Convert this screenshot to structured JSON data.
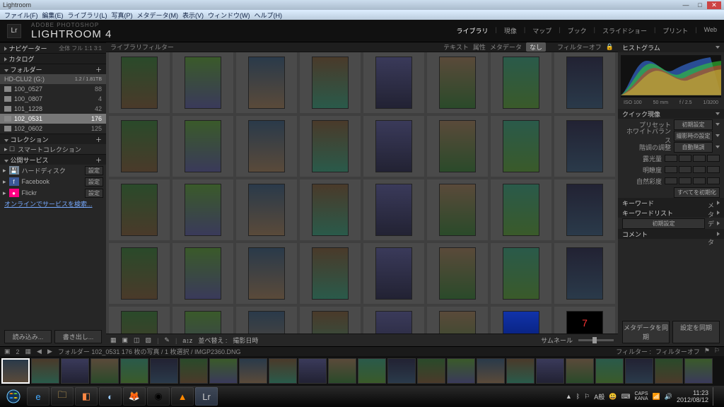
{
  "titlebar": {
    "title": "Lightroom"
  },
  "menubar": [
    "ファイル(F)",
    "編集(E)",
    "ライブラリ(L)",
    "写真(P)",
    "メタデータ(M)",
    "表示(V)",
    "ウィンドウ(W)",
    "ヘルプ(H)"
  ],
  "idplate": {
    "brand": "ADOBE PHOTOSHOP",
    "product": "LIGHTROOM 4",
    "modules": [
      "ライブラリ",
      "現像",
      "マップ",
      "ブック",
      "スライドショー",
      "プリント",
      "Web"
    ],
    "active_module": 0
  },
  "left": {
    "navigator": {
      "title": "ナビゲーター",
      "opts": [
        "全体",
        "フル",
        "1:1",
        "3:1"
      ]
    },
    "catalog_title": "カタログ",
    "folders": {
      "title": "フォルダー",
      "volume": {
        "name": "HD-CLU2 (G:)",
        "meta": "1.2 / 1.81TB"
      },
      "items": [
        {
          "name": "100_0527",
          "count": 88
        },
        {
          "name": "100_0807",
          "count": 4
        },
        {
          "name": "101_1228",
          "count": 42
        },
        {
          "name": "102_0531",
          "count": 176,
          "selected": true
        },
        {
          "name": "102_0602",
          "count": 125
        }
      ]
    },
    "collections": {
      "title": "コレクション",
      "smart": "スマートコレクション"
    },
    "services": {
      "title": "公開サービス",
      "items": [
        {
          "icon": "hdd",
          "name": "ハードディスク",
          "btn": "設定"
        },
        {
          "icon": "fb",
          "name": "Facebook",
          "btn": "設定"
        },
        {
          "icon": "flickr",
          "name": "Flickr",
          "btn": "設定"
        }
      ],
      "find": "オンラインでサービスを検索..."
    },
    "import_btn": "読み込み...",
    "export_btn": "書き出し..."
  },
  "filterbar": {
    "label": "ライブラリフィルター",
    "tabs": [
      "テキスト",
      "属性",
      "メタデータ",
      "なし"
    ],
    "off": "フィルターオフ"
  },
  "toolbar": {
    "sort_label": "並べ替え :",
    "sort_value": "撮影日時"
  },
  "right": {
    "histogram_title": "ヒストグラム",
    "histo_meta": [
      "ISO 100",
      "50 mm",
      "f / 2.5",
      "1/3200"
    ],
    "quick_title": "クイック現像",
    "preset": {
      "label": "プリセット",
      "value": "初期設定"
    },
    "wb": {
      "label": "ホワイトバランス",
      "value": "撮影時の設定"
    },
    "tone": {
      "label": "階調の調整",
      "value": "自動階調"
    },
    "sliders": [
      "露光量",
      "明瞭度",
      "自然彩度"
    ],
    "reset": "すべてを初期化",
    "keyword_title": "キーワード",
    "keywordlist_title": "キーワードリスト",
    "meta": {
      "label": "初期設定",
      "value": "メタデータ"
    },
    "comment_title": "コメント",
    "thumb_label": "サムネール",
    "sync_meta": "メタデータを同期",
    "sync_settings": "設定を同期"
  },
  "filmstrip": {
    "breadcrumb": [
      "フォルダー",
      "102_0531",
      "176 枚の写真 / 1 枚選択 / IMGP2360.DNG"
    ],
    "filter_label": "フィルター :",
    "filter_off": "フィルターオフ"
  },
  "taskbar": {
    "ime": "A般",
    "time": "11:23",
    "date": "2012/08/12"
  },
  "gridcount": 40,
  "filmcount": 24
}
